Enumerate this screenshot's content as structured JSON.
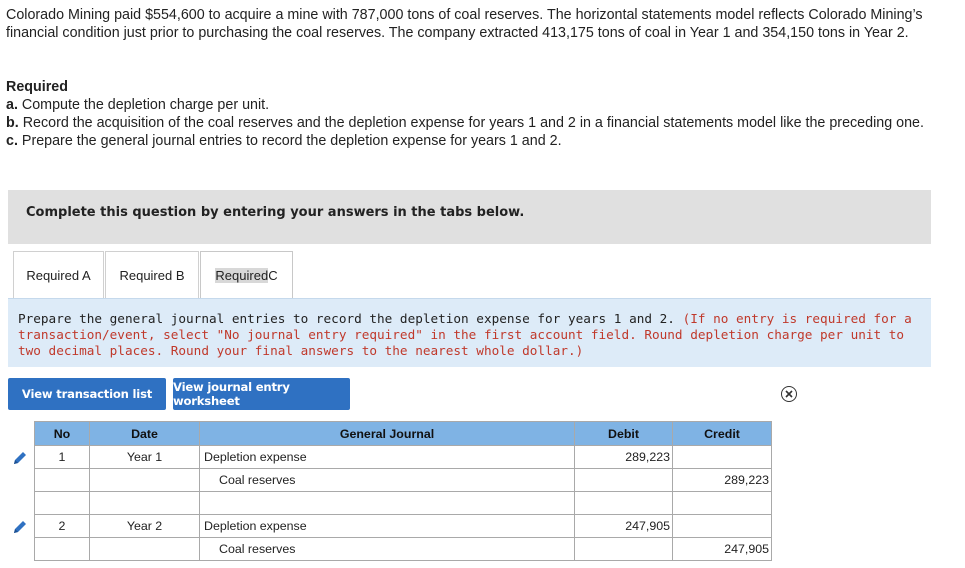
{
  "problem": {
    "intro": "Colorado Mining paid $554,600 to acquire a mine with 787,000 tons of coal reserves. The horizontal statements model reflects Colorado Mining’s financial condition just prior to purchasing the coal reserves. The company extracted 413,175 tons of coal in Year 1 and 354,150 tons in Year 2.",
    "required_heading": "Required",
    "items": [
      {
        "letter": "a.",
        "text": " Compute the depletion charge per unit."
      },
      {
        "letter": "b.",
        "text": " Record the acquisition of the coal reserves and the depletion expense for years 1 and 2 in a financial statements model like the preceding one."
      },
      {
        "letter": "c.",
        "text": " Prepare the general journal entries to record the depletion expense for years 1 and 2."
      }
    ]
  },
  "banner": "Complete this question by entering your answers in the tabs below.",
  "tabs": [
    {
      "label": "Required A"
    },
    {
      "label": "Required B"
    },
    {
      "label_hl": "Required",
      "label_rest": " C"
    }
  ],
  "instructions": {
    "main": "Prepare the general journal entries to record the depletion expense for years 1 and 2. ",
    "note": "(If no entry is required for a transaction/event, select \"No journal entry required\" in the first account field. Round depletion charge per unit to two decimal places. Round your final answers to the nearest whole dollar.)"
  },
  "buttons": {
    "view_transactions": "View transaction list",
    "view_worksheet": "View journal entry worksheet"
  },
  "journal": {
    "headers": {
      "no": "No",
      "date": "Date",
      "general_journal": "General Journal",
      "debit": "Debit",
      "credit": "Credit"
    },
    "rows": [
      {
        "no": "1",
        "date": "Year 1",
        "account": "Depletion expense",
        "debit": "289,223",
        "credit": ""
      },
      {
        "no": "",
        "date": "",
        "account": "Coal reserves",
        "debit": "",
        "credit": "289,223"
      },
      {
        "no": "",
        "date": "",
        "account": "",
        "debit": "",
        "credit": ""
      },
      {
        "no": "2",
        "date": "Year 2",
        "account": "Depletion expense",
        "debit": "247,905",
        "credit": ""
      },
      {
        "no": "",
        "date": "",
        "account": "Coal reserves",
        "debit": "",
        "credit": "247,905"
      }
    ]
  },
  "colors": {
    "accent": "#2f71c2",
    "header": "#7fb3e4",
    "instructions_bg": "#ddebf8",
    "note_red": "#c0392b"
  }
}
